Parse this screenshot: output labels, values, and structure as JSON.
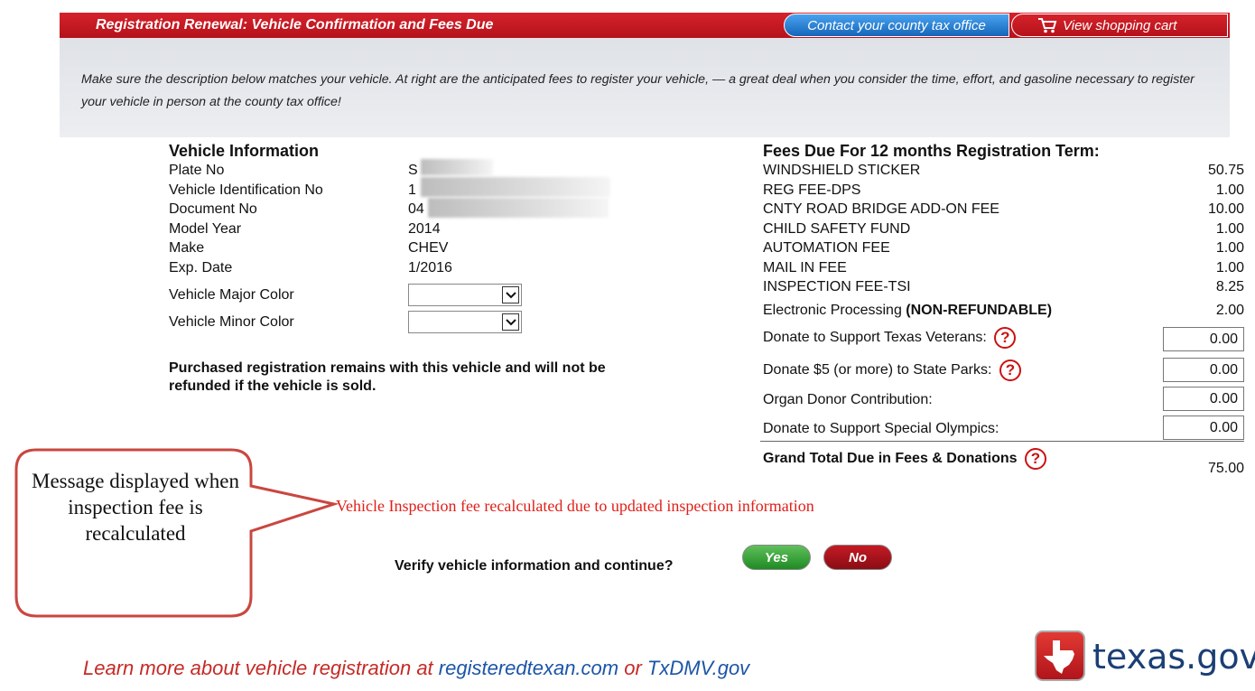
{
  "header": {
    "title": "Registration Renewal: Vehicle Confirmation and Fees Due",
    "contact_label": "Contact your county tax office",
    "cart_label": "View shopping cart",
    "brand_red": "#c41a22",
    "brand_blue": "#1e6fc4"
  },
  "intro": {
    "text": "Make sure the description below matches your vehicle. At right are the anticipated fees to register your vehicle, — a great deal when you consider the time, effort, and gasoline necessary to register your vehicle in person at the county tax office!"
  },
  "vehicle": {
    "heading": "Vehicle Information",
    "rows": [
      {
        "label": "Plate No",
        "value": "S"
      },
      {
        "label": "Vehicle Identification No",
        "value": "1"
      },
      {
        "label": "Document No",
        "value": "04"
      },
      {
        "label": "Model Year",
        "value": "2014"
      },
      {
        "label": "Make",
        "value": "CHEV"
      },
      {
        "label": "Exp. Date",
        "value": "1/2016"
      }
    ],
    "major_color_label": "Vehicle Major Color",
    "minor_color_label": "Vehicle Minor Color",
    "major_color_value": "",
    "minor_color_value": "",
    "notice": "Purchased registration remains with this vehicle and will not be refunded if the vehicle is sold."
  },
  "fees": {
    "heading": "Fees Due For 12 months Registration Term:",
    "items": [
      {
        "label": "WINDSHIELD STICKER",
        "amount": "50.75"
      },
      {
        "label": "REG FEE-DPS",
        "amount": "1.00"
      },
      {
        "label": "CNTY ROAD BRIDGE ADD-ON FEE",
        "amount": "10.00"
      },
      {
        "label": "CHILD SAFETY FUND",
        "amount": "1.00"
      },
      {
        "label": "AUTOMATION FEE",
        "amount": "1.00"
      },
      {
        "label": "MAIL IN FEE",
        "amount": "1.00"
      },
      {
        "label": "INSPECTION FEE-TSI",
        "amount": "8.25"
      }
    ],
    "electronic_label": "Electronic Processing",
    "electronic_bold": "(NON-REFUNDABLE)",
    "electronic_amount": "2.00",
    "donations": [
      {
        "label": "Donate to Support Texas Veterans:",
        "amount": "0.00",
        "help": true
      },
      {
        "label": "Donate $5 (or more) to State Parks:",
        "amount": "0.00",
        "help": true
      },
      {
        "label": "Organ Donor Contribution:",
        "amount": "0.00",
        "help": false
      },
      {
        "label": "Donate to Support Special Olympics:",
        "amount": "0.00",
        "help": false
      }
    ],
    "total_label": "Grand Total Due in Fees & Donations",
    "total_amount": "75.00",
    "help_glyph": "?"
  },
  "callout": {
    "text": "Message displayed when inspection fee is recalculated"
  },
  "recalc_message": "Vehicle Inspection fee recalculated due to updated inspection information",
  "verify": {
    "question": "Verify vehicle information and continue?",
    "yes_label": "Yes",
    "no_label": "No"
  },
  "footer": {
    "prefix": "Learn more about vehicle registration at ",
    "link1": "registeredtexan.com",
    "middle": " or ",
    "link2": "TxDMV.gov",
    "logo_text": "texas.gov"
  }
}
